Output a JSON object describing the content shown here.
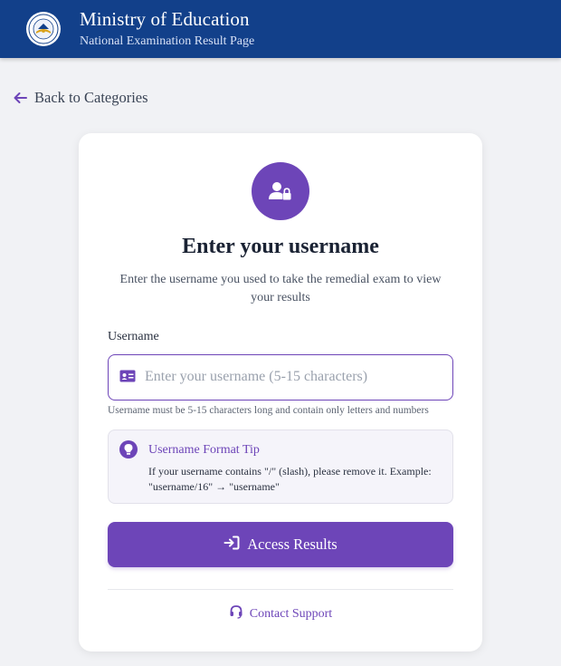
{
  "header": {
    "title": "Ministry of Education",
    "subtitle": "National Examination Result Page",
    "logo_icon": "ministry-seal-icon",
    "background_color": "#12408a"
  },
  "nav": {
    "back_label": "Back to Categories",
    "back_icon": "arrow-left-icon"
  },
  "card": {
    "icon": "user-lock-icon",
    "title": "Enter your username",
    "description": "Enter the username you used to take the remedial exam to view your results",
    "username_label": "Username",
    "username_placeholder": "Enter your username (5-15 characters)",
    "username_value": "",
    "username_icon": "id-card-icon",
    "hint": "Username must be 5-15 characters long and contain only letters and numbers",
    "tip": {
      "icon": "lightbulb-icon",
      "title": "Username Format Tip",
      "text": "If your username contains \"/\" (slash), please remove it. Example: \"username/16\" → \"username\""
    },
    "submit_label": "Access Results",
    "submit_icon": "sign-in-icon",
    "support_label": "Contact Support",
    "support_icon": "headset-icon"
  },
  "colors": {
    "accent": "#6d45b8",
    "page_background": "#f1f2f5"
  }
}
